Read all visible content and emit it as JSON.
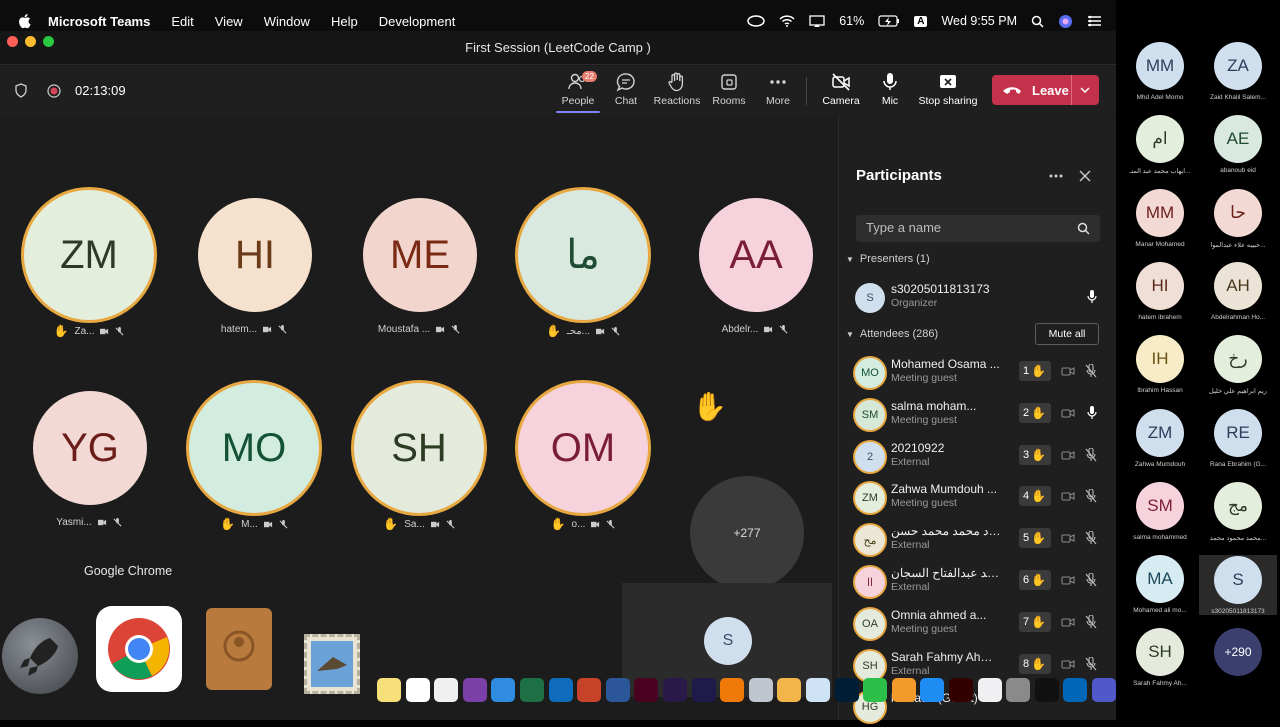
{
  "menubar": {
    "app": "Microsoft Teams",
    "items": [
      "Edit",
      "View",
      "Window",
      "Help",
      "Development"
    ],
    "battery": "61%",
    "datetime": "Wed 9:55 PM",
    "input_label": "A"
  },
  "window": {
    "title": "First Session (LeetCode Camp )"
  },
  "toolbar": {
    "timer": "02:13:09",
    "people": "People",
    "people_badge": "22",
    "chat": "Chat",
    "reactions": "Reactions",
    "rooms": "Rooms",
    "more": "More",
    "camera": "Camera",
    "mic": "Mic",
    "stop_sharing": "Stop sharing",
    "leave": "Leave"
  },
  "stage": {
    "tiles": [
      {
        "initials": "ZM",
        "label": "Za...",
        "bg": "#e3eedc",
        "fg": "#2e3b24",
        "hand": true
      },
      {
        "initials": "HI",
        "label": "hatem...",
        "bg": "#f6e1cf",
        "fg": "#6b3a18",
        "hand": false
      },
      {
        "initials": "ME",
        "label": "Moustafa ...",
        "bg": "#f2d6cd",
        "fg": "#7a2a14",
        "hand": false
      },
      {
        "initials": "ما",
        "label": "محـ...",
        "bg": "#d9e9df",
        "fg": "#1f4a33",
        "hand": true
      },
      {
        "initials": "AA",
        "label": "Abdelr...",
        "bg": "#f6d3dc",
        "fg": "#7a1d38",
        "hand": false
      },
      {
        "initials": "YG",
        "label": "Yasmi...",
        "bg": "#f3d9d4",
        "fg": "#6b1d1a",
        "hand": false
      },
      {
        "initials": "MO",
        "label": "M...",
        "bg": "#d3ece0",
        "fg": "#145235",
        "hand": true
      },
      {
        "initials": "SH",
        "label": "Sa...",
        "bg": "#e4ebdc",
        "fg": "#2e3b24",
        "hand": true
      },
      {
        "initials": "OM",
        "label": "o...",
        "bg": "#f6d3dc",
        "fg": "#7a1d38",
        "hand": true
      }
    ],
    "overflow": "+277",
    "self_initial": "S",
    "tooltip": "Google Chrome"
  },
  "participants": {
    "title": "Participants",
    "search_placeholder": "Type a name",
    "presenters_label": "Presenters (1)",
    "presenter": {
      "initial": "S",
      "name": "s30205011813173",
      "role": "Organizer"
    },
    "attendees_label": "Attendees (286)",
    "mute_all": "Mute all",
    "attendees": [
      {
        "initials": "MO",
        "name": "Mohamed Osama ...",
        "role": "Meeting guest",
        "hand": "1",
        "bg": "#d3ece0",
        "fg": "#145235"
      },
      {
        "initials": "SM",
        "name": "salma moham...",
        "role": "Meeting guest",
        "hand": "2",
        "bg": "#d6e8d8",
        "fg": "#1f4a33"
      },
      {
        "initials": "2",
        "name": "20210922",
        "role": "External",
        "hand": "3",
        "bg": "#cfdfee",
        "fg": "#3a4b6b"
      },
      {
        "initials": "ZM",
        "name": "Zahwa Mumdouh ...",
        "role": "Meeting guest",
        "hand": "4",
        "bg": "#e3eedc",
        "fg": "#2e3b24"
      },
      {
        "initials": "مح",
        "name": "محمود محمد محمد حسن...",
        "role": "External",
        "hand": "5",
        "bg": "#ebe7d6",
        "fg": "#4a3f1a"
      },
      {
        "initials": "اا",
        "name": "السيد عبدالفتاح السجان...",
        "role": "External",
        "hand": "6",
        "bg": "#f6d3dc",
        "fg": "#7a1d38"
      },
      {
        "initials": "OA",
        "name": "Omnia ahmed a...",
        "role": "Meeting guest",
        "hand": "7",
        "bg": "#e4ebdc",
        "fg": "#2e3b24"
      },
      {
        "initials": "SH",
        "name": "Sarah Fahmy Ahme...",
        "role": "External",
        "hand": "8",
        "bg": "#e4ebdc",
        "fg": "#2e3b24"
      },
      {
        "initials": "HG",
        "name": "hamada (Guest)",
        "role": "",
        "hand": "",
        "bg": "#e4ebdc",
        "fg": "#2e3b24"
      }
    ]
  },
  "side_gallery": [
    {
      "initials": "MM",
      "name": "Mhd Adel Momo",
      "bg": "#cfdfee",
      "fg": "#2c3e5c"
    },
    {
      "initials": "ZA",
      "name": "Zaid Khalil Salem...",
      "bg": "#cfdfee",
      "fg": "#2c3e5c"
    },
    {
      "initials": "ام",
      "name": "ايهاب محمد عبد المنـ...",
      "bg": "#e3eedc",
      "fg": "#2e3b24"
    },
    {
      "initials": "AE",
      "name": "abanoub eid",
      "bg": "#d9e9df",
      "fg": "#1f4a33"
    },
    {
      "initials": "MM",
      "name": "Manar Mohamed",
      "bg": "#f3d9d4",
      "fg": "#6b1d1a"
    },
    {
      "initials": "حا",
      "name": "حبيبه علاء عبدالموا...",
      "bg": "#f3d9d4",
      "fg": "#6b1d1a"
    },
    {
      "initials": "HI",
      "name": "hatem ibrahem",
      "bg": "#f0dfd6",
      "fg": "#5a2a18"
    },
    {
      "initials": "AH",
      "name": "Abdelrahman Ho...",
      "bg": "#ebe3d6",
      "fg": "#4a3a20"
    },
    {
      "initials": "IH",
      "name": "Ibrahim Hassan",
      "bg": "#f7ecc7",
      "fg": "#6a5313"
    },
    {
      "initials": "رخ",
      "name": "ريم ابراهيم علي خليل",
      "bg": "#e3eedc",
      "fg": "#2e3b24"
    },
    {
      "initials": "ZM",
      "name": "Zahwa Mumdouh",
      "bg": "#cfdfee",
      "fg": "#2c3e5c"
    },
    {
      "initials": "RE",
      "name": "Rana Ebrahim (G...",
      "bg": "#cfdfee",
      "fg": "#2c3e5c"
    },
    {
      "initials": "SM",
      "name": "salma mohammed",
      "bg": "#f6d3dc",
      "fg": "#7a1d38"
    },
    {
      "initials": "مج",
      "name": "محمد محمود محمد...",
      "bg": "#e3eedc",
      "fg": "#2e3b24"
    },
    {
      "initials": "MA",
      "name": "Mohamed ali mo...",
      "bg": "#d6ecf2",
      "fg": "#1c4a5a"
    },
    {
      "initials": "S",
      "name": "s30205011813173",
      "bg": "#cfdfee",
      "fg": "#2c3e5c"
    },
    {
      "initials": "SH",
      "name": "Sarah Fahmy Ah...",
      "bg": "#e4ebdc",
      "fg": "#2e3b24"
    },
    {
      "initials": "+290",
      "name": "",
      "bg": "#3a3f6e",
      "fg": "#ffffff"
    }
  ],
  "colors": {
    "accent": "#7f85f5",
    "leave": "#c4314b",
    "hand": "#e7a741"
  }
}
